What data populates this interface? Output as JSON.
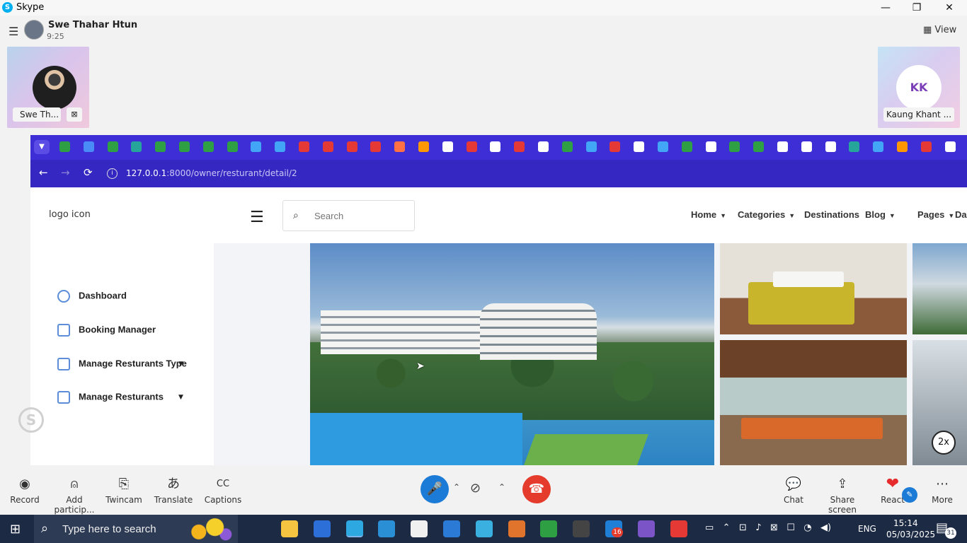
{
  "app": {
    "title": "Skype"
  },
  "window_controls": {
    "minimize": "—",
    "restore": "❐",
    "close": "✕"
  },
  "call": {
    "caller_name": "Swe Thahar Htun",
    "duration": "9:25",
    "view_label": "View",
    "view_icon": "grid-icon"
  },
  "participants": [
    {
      "label": "Swe Th...",
      "icon": "close-box-icon"
    },
    {
      "initials": "KK",
      "label": "Kaung Khant ..."
    }
  ],
  "browser": {
    "url_host": "127.0.0.1",
    "url_path": ":8000/owner/resturant/detail/2",
    "back": "←",
    "forward": "→",
    "reload": "⟳",
    "bookmark_colors": [
      "#2ea043",
      "#4a8cf7",
      "#2ea043",
      "#26a69a",
      "#2ea043",
      "#2ea043",
      "#2ea043",
      "#2ea043",
      "#42a5f5",
      "#42a5f5",
      "#e53935",
      "#e53935",
      "#e53935",
      "#e53935",
      "#ff7043",
      "#ff9800",
      "#ffffff",
      "#e53935",
      "#ffffff",
      "#e53935",
      "#ffffff",
      "#2ea043",
      "#42a5f5",
      "#e53935",
      "#ffffff",
      "#42a5f5",
      "#2ea043",
      "#ffffff",
      "#2ea043",
      "#2ea043",
      "#ffffff",
      "#ffffff",
      "#ffffff",
      "#26a69a",
      "#42a5f5",
      "#ff9800",
      "#e53935",
      "#ffffff",
      "#ffffff"
    ]
  },
  "site": {
    "logo_alt": "logo icon",
    "search_placeholder": "Search",
    "nav": [
      {
        "label": "Home",
        "caret": true
      },
      {
        "label": "Categories",
        "caret": true
      },
      {
        "label": "Destinations",
        "caret": false
      },
      {
        "label": "Blog",
        "caret": true
      },
      {
        "label": "Pages",
        "caret": true
      },
      {
        "label": "Das",
        "caret": false
      }
    ],
    "sidebar": [
      {
        "label": "Dashboard"
      },
      {
        "label": "Booking Manager"
      },
      {
        "label": "Manage Resturants Type"
      },
      {
        "label": "Manage Resturants"
      }
    ]
  },
  "overlay": {
    "zoom": "2x"
  },
  "controls": {
    "left": [
      {
        "label": "Record",
        "icon": "◉"
      },
      {
        "label": "Add particip...",
        "icon": "⍝"
      },
      {
        "label": "Twincam",
        "icon": "⎘"
      },
      {
        "label": "Translate",
        "icon": "あ"
      },
      {
        "label": "Captions",
        "icon": "CC"
      }
    ],
    "mic_icon": "🎤",
    "cam_icon": "⊘",
    "hangup_icon": "☎",
    "caret": "⌃",
    "right": [
      {
        "label": "Chat",
        "icon": "💬"
      },
      {
        "label": "Share screen",
        "icon": "⇪"
      },
      {
        "label": "React",
        "icon": "❤"
      },
      {
        "label": "More",
        "icon": "⋯"
      }
    ]
  },
  "taskbar": {
    "search_text": "Type here to search",
    "viber_badge": "16",
    "lang": "ENG",
    "time": "15:14",
    "date": "05/03/2025",
    "notifications": "31",
    "app_colors": [
      "#f5c542",
      "#2d6fd8",
      "#2ea8e0",
      "#2b8fd6",
      "#f0f0f0",
      "#2b7bd6",
      "#3ab0e0",
      "#e0742c",
      "#2ea043",
      "#444444",
      "#1f7fd6",
      "#7b55c8",
      "#e53935"
    ]
  }
}
